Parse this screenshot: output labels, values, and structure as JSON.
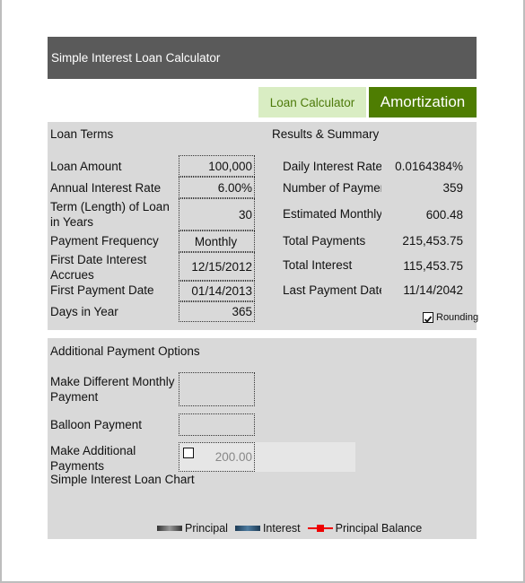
{
  "header": {
    "title": "Simple Interest Loan Calculator"
  },
  "tabs": [
    {
      "label": "Loan Calculator",
      "active": false
    },
    {
      "label": "Amortization",
      "active": true
    }
  ],
  "loan_terms": {
    "heading": "Loan Terms",
    "fields": [
      {
        "label": "Loan Amount",
        "value": "100,000"
      },
      {
        "label": "Annual Interest Rate",
        "value": "6.00%"
      },
      {
        "label": "Term (Length) of Loan in Years",
        "value": "30"
      },
      {
        "label": "Payment Frequency",
        "value": "Monthly"
      },
      {
        "label": "First Date Interest Accrues",
        "value": "12/15/2012"
      },
      {
        "label": "First Payment Date",
        "value": "01/14/2013"
      },
      {
        "label": "Days in Year",
        "value": "365"
      }
    ]
  },
  "results": {
    "heading": "Results & Summary",
    "rows": [
      {
        "label": "Daily Interest Rate",
        "value": "0.0164384%"
      },
      {
        "label": "Number of Payments",
        "value": "359"
      },
      {
        "label": "Estimated Monthly",
        "value": "600.48"
      },
      {
        "label": "Total Payments",
        "value": "215,453.75"
      },
      {
        "label": "Total Interest",
        "value": "115,453.75"
      },
      {
        "label": "Last Payment Date",
        "value": "11/14/2042"
      }
    ],
    "rounding_label": "Rounding",
    "rounding_checked": true
  },
  "additional": {
    "heading": "Additional Payment Options",
    "different_monthly_label": "Make Different Monthly Payment",
    "different_monthly_value": "",
    "balloon_label": "Balloon Payment",
    "balloon_value": "",
    "additional_label": "Make Additional Payments",
    "additional_checked": false,
    "additional_value": "200.00"
  },
  "chart": {
    "title": "Simple Interest Loan Chart",
    "legend": [
      "Principal",
      "Interest",
      "Principal Balance"
    ]
  }
}
